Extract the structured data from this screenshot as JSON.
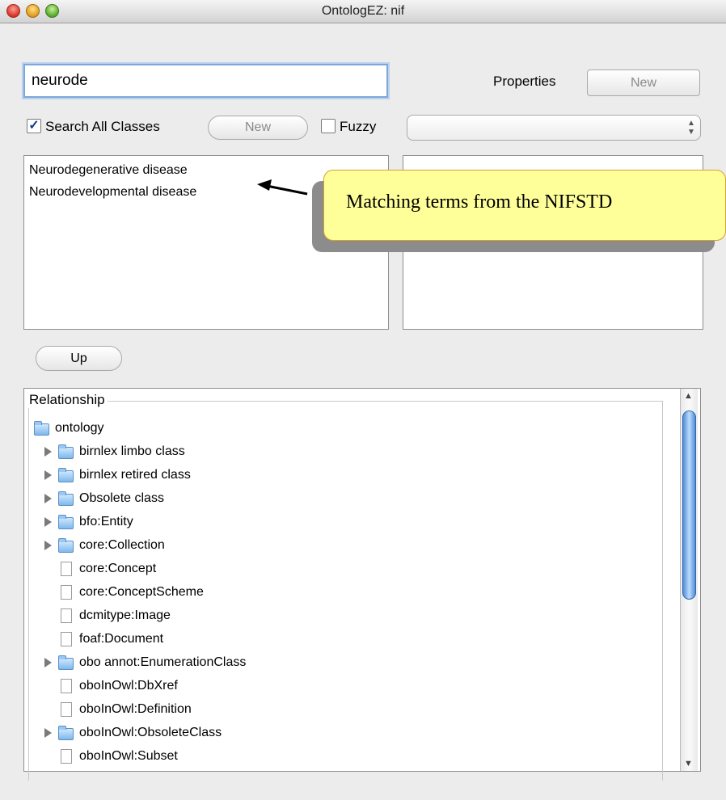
{
  "window": {
    "title": "OntologEZ: nif"
  },
  "search": {
    "value": "neurode"
  },
  "properties_label": "Properties",
  "properties_new_button": "New",
  "search_all_label": "Search All Classes",
  "search_all_checked": "✓",
  "search_new_button": "New",
  "fuzzy_label": "Fuzzy",
  "popup_arrows": "▲▼",
  "results": [
    "Neurodegenerative disease",
    "Neurodevelopmental disease"
  ],
  "callout_text": "Matching terms from the NIFSTD",
  "up_button": "Up",
  "relationship_label": "Relationship",
  "tree": {
    "root": {
      "label": "ontology",
      "icon": "folder-icon"
    },
    "items": [
      {
        "label": "birnlex limbo class",
        "icon": "folder-icon",
        "expandable": true
      },
      {
        "label": "birnlex retired class",
        "icon": "folder-icon",
        "expandable": true
      },
      {
        "label": "Obsolete class",
        "icon": "folder-icon",
        "expandable": true
      },
      {
        "label": "bfo:Entity",
        "icon": "folder-icon",
        "expandable": true
      },
      {
        "label": "core:Collection",
        "icon": "folder-icon",
        "expandable": true
      },
      {
        "label": "core:Concept",
        "icon": "document-icon",
        "expandable": false
      },
      {
        "label": "core:ConceptScheme",
        "icon": "document-icon",
        "expandable": false
      },
      {
        "label": "dcmitype:Image",
        "icon": "document-icon",
        "expandable": false
      },
      {
        "label": "foaf:Document",
        "icon": "document-icon",
        "expandable": false
      },
      {
        "label": "obo annot:EnumerationClass",
        "icon": "folder-icon",
        "expandable": true
      },
      {
        "label": "oboInOwl:DbXref",
        "icon": "document-icon",
        "expandable": false
      },
      {
        "label": "oboInOwl:Definition",
        "icon": "document-icon",
        "expandable": false
      },
      {
        "label": "oboInOwl:ObsoleteClass",
        "icon": "folder-icon",
        "expandable": true
      },
      {
        "label": "oboInOwl:Subset",
        "icon": "document-icon",
        "expandable": false
      }
    ]
  },
  "scroll_up_arrow": "▲",
  "scroll_down_arrow": "▼"
}
